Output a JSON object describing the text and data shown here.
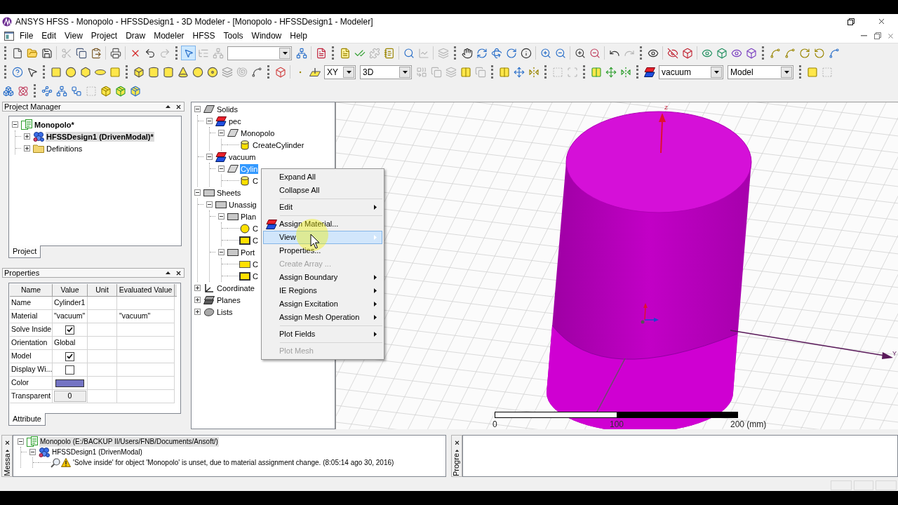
{
  "window": {
    "title": "ANSYS HFSS - Monopolo - HFSSDesign1 - 3D Modeler - [Monopolo - HFSSDesign1 - Modeler]"
  },
  "menu_bar": [
    "File",
    "Edit",
    "View",
    "Project",
    "Draw",
    "Modeler",
    "HFSS",
    "Tools",
    "Window",
    "Help"
  ],
  "toolbar": {
    "toggle_tool": {
      "on": true
    },
    "drawing_plane": "XY",
    "drawing_mode": "3D",
    "material": "vacuum",
    "model_type": "Model"
  },
  "project_manager": {
    "title": "Project Manager",
    "tree": [
      {
        "label": "Monopolo*",
        "kind": "project",
        "expanded": true,
        "selected": false,
        "children": [
          {
            "label": "HFSSDesign1 (DrivenModal)*",
            "kind": "design",
            "expanded": false,
            "selected": true
          },
          {
            "label": "Definitions",
            "kind": "folder",
            "expanded": false,
            "selected": false
          }
        ]
      }
    ],
    "tabs": [
      {
        "label": "Project",
        "selected": true
      }
    ]
  },
  "properties": {
    "title": "Properties",
    "columns": [
      "Name",
      "Value",
      "Unit",
      "Evaluated Value"
    ],
    "rows": [
      {
        "name": "Name",
        "kind": "text",
        "value": "Cylinder1"
      },
      {
        "name": "Material",
        "kind": "text",
        "value": "\"vacuum\"",
        "evaluated_value": "\"vacuum\""
      },
      {
        "name": "Solve Inside",
        "kind": "checkbox",
        "checked": true
      },
      {
        "name": "Orientation",
        "kind": "text",
        "value": "Global"
      },
      {
        "name": "Model",
        "kind": "checkbox",
        "checked": true
      },
      {
        "name": "Display Wi...",
        "kind": "checkbox",
        "checked": false
      },
      {
        "name": "Color",
        "kind": "color",
        "color": "#7474c4"
      },
      {
        "name": "Transparent",
        "kind": "spin",
        "value": "0"
      }
    ],
    "tabs": [
      {
        "label": "Attribute",
        "selected": true
      }
    ]
  },
  "model_tree": [
    {
      "label": "Solids",
      "kind": "group",
      "expanded": true,
      "selected": false,
      "children": [
        {
          "label": "pec",
          "kind": "material",
          "expanded": true,
          "selected": false,
          "children": [
            {
              "label": "Monopolo",
              "kind": "solid",
              "expanded": true,
              "selected": false,
              "children": [
                {
                  "label": "CreateCylinder",
                  "kind": "cylinder",
                  "selected": false
                }
              ]
            }
          ]
        },
        {
          "label": "vacuum",
          "kind": "material",
          "expanded": true,
          "selected": false,
          "children": [
            {
              "label": "Cylin",
              "kind": "solid",
              "expanded": true,
              "selected": true,
              "children": [
                {
                  "label": "C",
                  "kind": "cylinder",
                  "selected": false
                }
              ]
            }
          ]
        }
      ]
    },
    {
      "label": "Sheets",
      "kind": "sheet",
      "expanded": true,
      "selected": false,
      "children": [
        {
          "label": "Unassig",
          "kind": "sheet",
          "expanded": true,
          "selected": false,
          "children": [
            {
              "label": "Plan",
              "kind": "sheet",
              "expanded": true,
              "selected": false,
              "children": [
                {
                  "label": "C",
                  "kind": "circle",
                  "selected": false
                },
                {
                  "label": "C",
                  "kind": "rectangle",
                  "selected": false
                }
              ]
            },
            {
              "label": "Port",
              "kind": "sheet",
              "expanded": true,
              "selected": false,
              "children": [
                {
                  "label": "C",
                  "kind": "face",
                  "selected": false
                },
                {
                  "label": "C",
                  "kind": "rectangle",
                  "selected": false
                }
              ]
            }
          ]
        }
      ]
    },
    {
      "label": "Coordinate",
      "kind": "axes",
      "expanded": false,
      "selected": false
    },
    {
      "label": "Planes",
      "kind": "planes",
      "expanded": false,
      "selected": false
    },
    {
      "label": "Lists",
      "kind": "lists",
      "expanded": false,
      "selected": false
    }
  ],
  "context_menu": [
    {
      "kind": "command",
      "label": "Expand All",
      "submenu": false,
      "disabled": false,
      "selected": false
    },
    {
      "kind": "command",
      "label": "Collapse All",
      "submenu": false,
      "disabled": false,
      "selected": false
    },
    {
      "kind": "separator"
    },
    {
      "kind": "command",
      "label": "Edit",
      "submenu": true,
      "disabled": false,
      "selected": false
    },
    {
      "kind": "separator"
    },
    {
      "kind": "material",
      "label": "Assign Material...",
      "submenu": false,
      "disabled": false,
      "selected": false
    },
    {
      "kind": "command",
      "label": "View",
      "submenu": true,
      "disabled": false,
      "selected": true
    },
    {
      "kind": "command",
      "label": "Properties...",
      "submenu": false,
      "disabled": false,
      "selected": false
    },
    {
      "kind": "command",
      "label": "Create Array ...",
      "submenu": false,
      "disabled": true,
      "selected": false
    },
    {
      "kind": "command",
      "label": "Assign Boundary",
      "submenu": true,
      "disabled": false,
      "selected": false
    },
    {
      "kind": "command",
      "label": "IE Regions",
      "submenu": true,
      "disabled": false,
      "selected": false
    },
    {
      "kind": "command",
      "label": "Assign Excitation",
      "submenu": true,
      "disabled": false,
      "selected": false
    },
    {
      "kind": "command",
      "label": "Assign Mesh Operation",
      "submenu": true,
      "disabled": false,
      "selected": false
    },
    {
      "kind": "separator"
    },
    {
      "kind": "command",
      "label": "Plot Fields",
      "submenu": true,
      "disabled": false,
      "selected": false
    },
    {
      "kind": "separator"
    },
    {
      "kind": "command",
      "label": "Plot Mesh",
      "submenu": false,
      "disabled": true,
      "selected": false
    }
  ],
  "viewport": {
    "axis_labels": [
      "Z",
      "Y"
    ],
    "scale_labels": [
      "0",
      "100",
      "200 (mm)"
    ]
  },
  "messages": {
    "tab": "Messa",
    "tree": [
      {
        "label": "Monopolo (E:/BACKUP II/Users/FNB/Documents/Ansoft/)",
        "kind": "project",
        "expanded": true,
        "selected": true,
        "children": [
          {
            "label": "HFSSDesign1 (DrivenModal)",
            "kind": "design",
            "expanded": true,
            "selected": false,
            "children": [
              {
                "label": "'Solve inside' for object 'Monopolo' is unset, due to material assignment change. (8:05:14 ago 30, 2016)",
                "kind": "warning",
                "selected": false
              }
            ]
          }
        ]
      }
    ]
  },
  "progress": {
    "tab": "Progre"
  }
}
